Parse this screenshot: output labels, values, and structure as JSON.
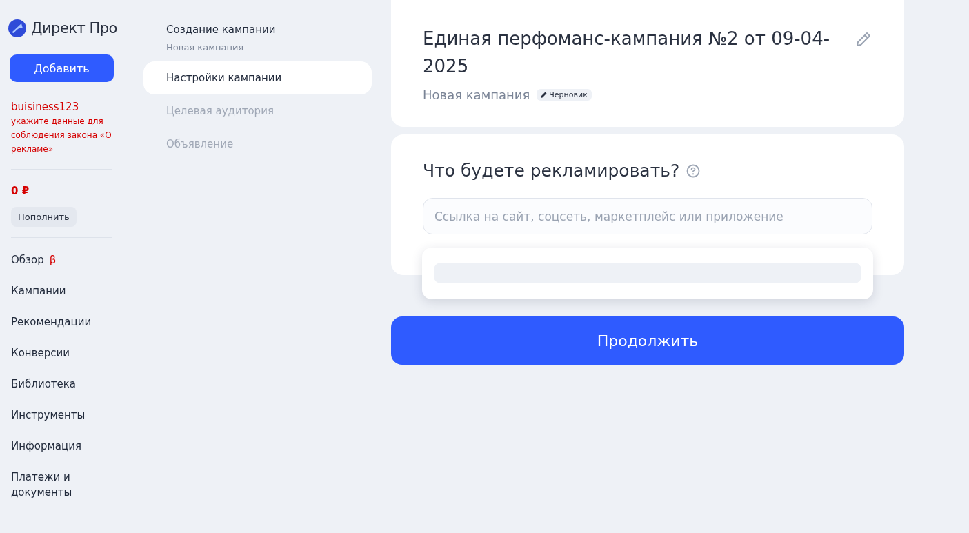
{
  "logo": {
    "text": "Директ Про"
  },
  "add_button": "Добавить",
  "account": {
    "login": "buisiness123",
    "warning": "укажите данные для соблюдения закона «О рекламе»"
  },
  "balance": {
    "amount": "0 ₽",
    "topup_button": "Пополнить"
  },
  "nav": [
    {
      "label": "Обзор",
      "badge": "β"
    },
    {
      "label": "Кампании"
    },
    {
      "label": "Рекомендации"
    },
    {
      "label": "Конверсии"
    },
    {
      "label": "Библиотека"
    },
    {
      "label": "Инструменты"
    },
    {
      "label": "Информация"
    },
    {
      "label": "Платежи и документы"
    }
  ],
  "steps": {
    "title": "Создание кампании",
    "subtitle": "Новая кампания",
    "items": [
      {
        "label": "Настройки кампании",
        "selected": true
      },
      {
        "label": "Целевая аудитория",
        "selected": false
      },
      {
        "label": "Объявление",
        "selected": false
      }
    ]
  },
  "campaign": {
    "title": "Единая перфоманс-кампания №2 от 09-04-2025",
    "subtitle": "Новая кампания",
    "status": "Черновик"
  },
  "question": {
    "title": "Что будете рекламировать?",
    "placeholder": "Ссылка на сайт, соцсеть, маркетплейс или приложение"
  },
  "continue_button": "Продолжить"
}
